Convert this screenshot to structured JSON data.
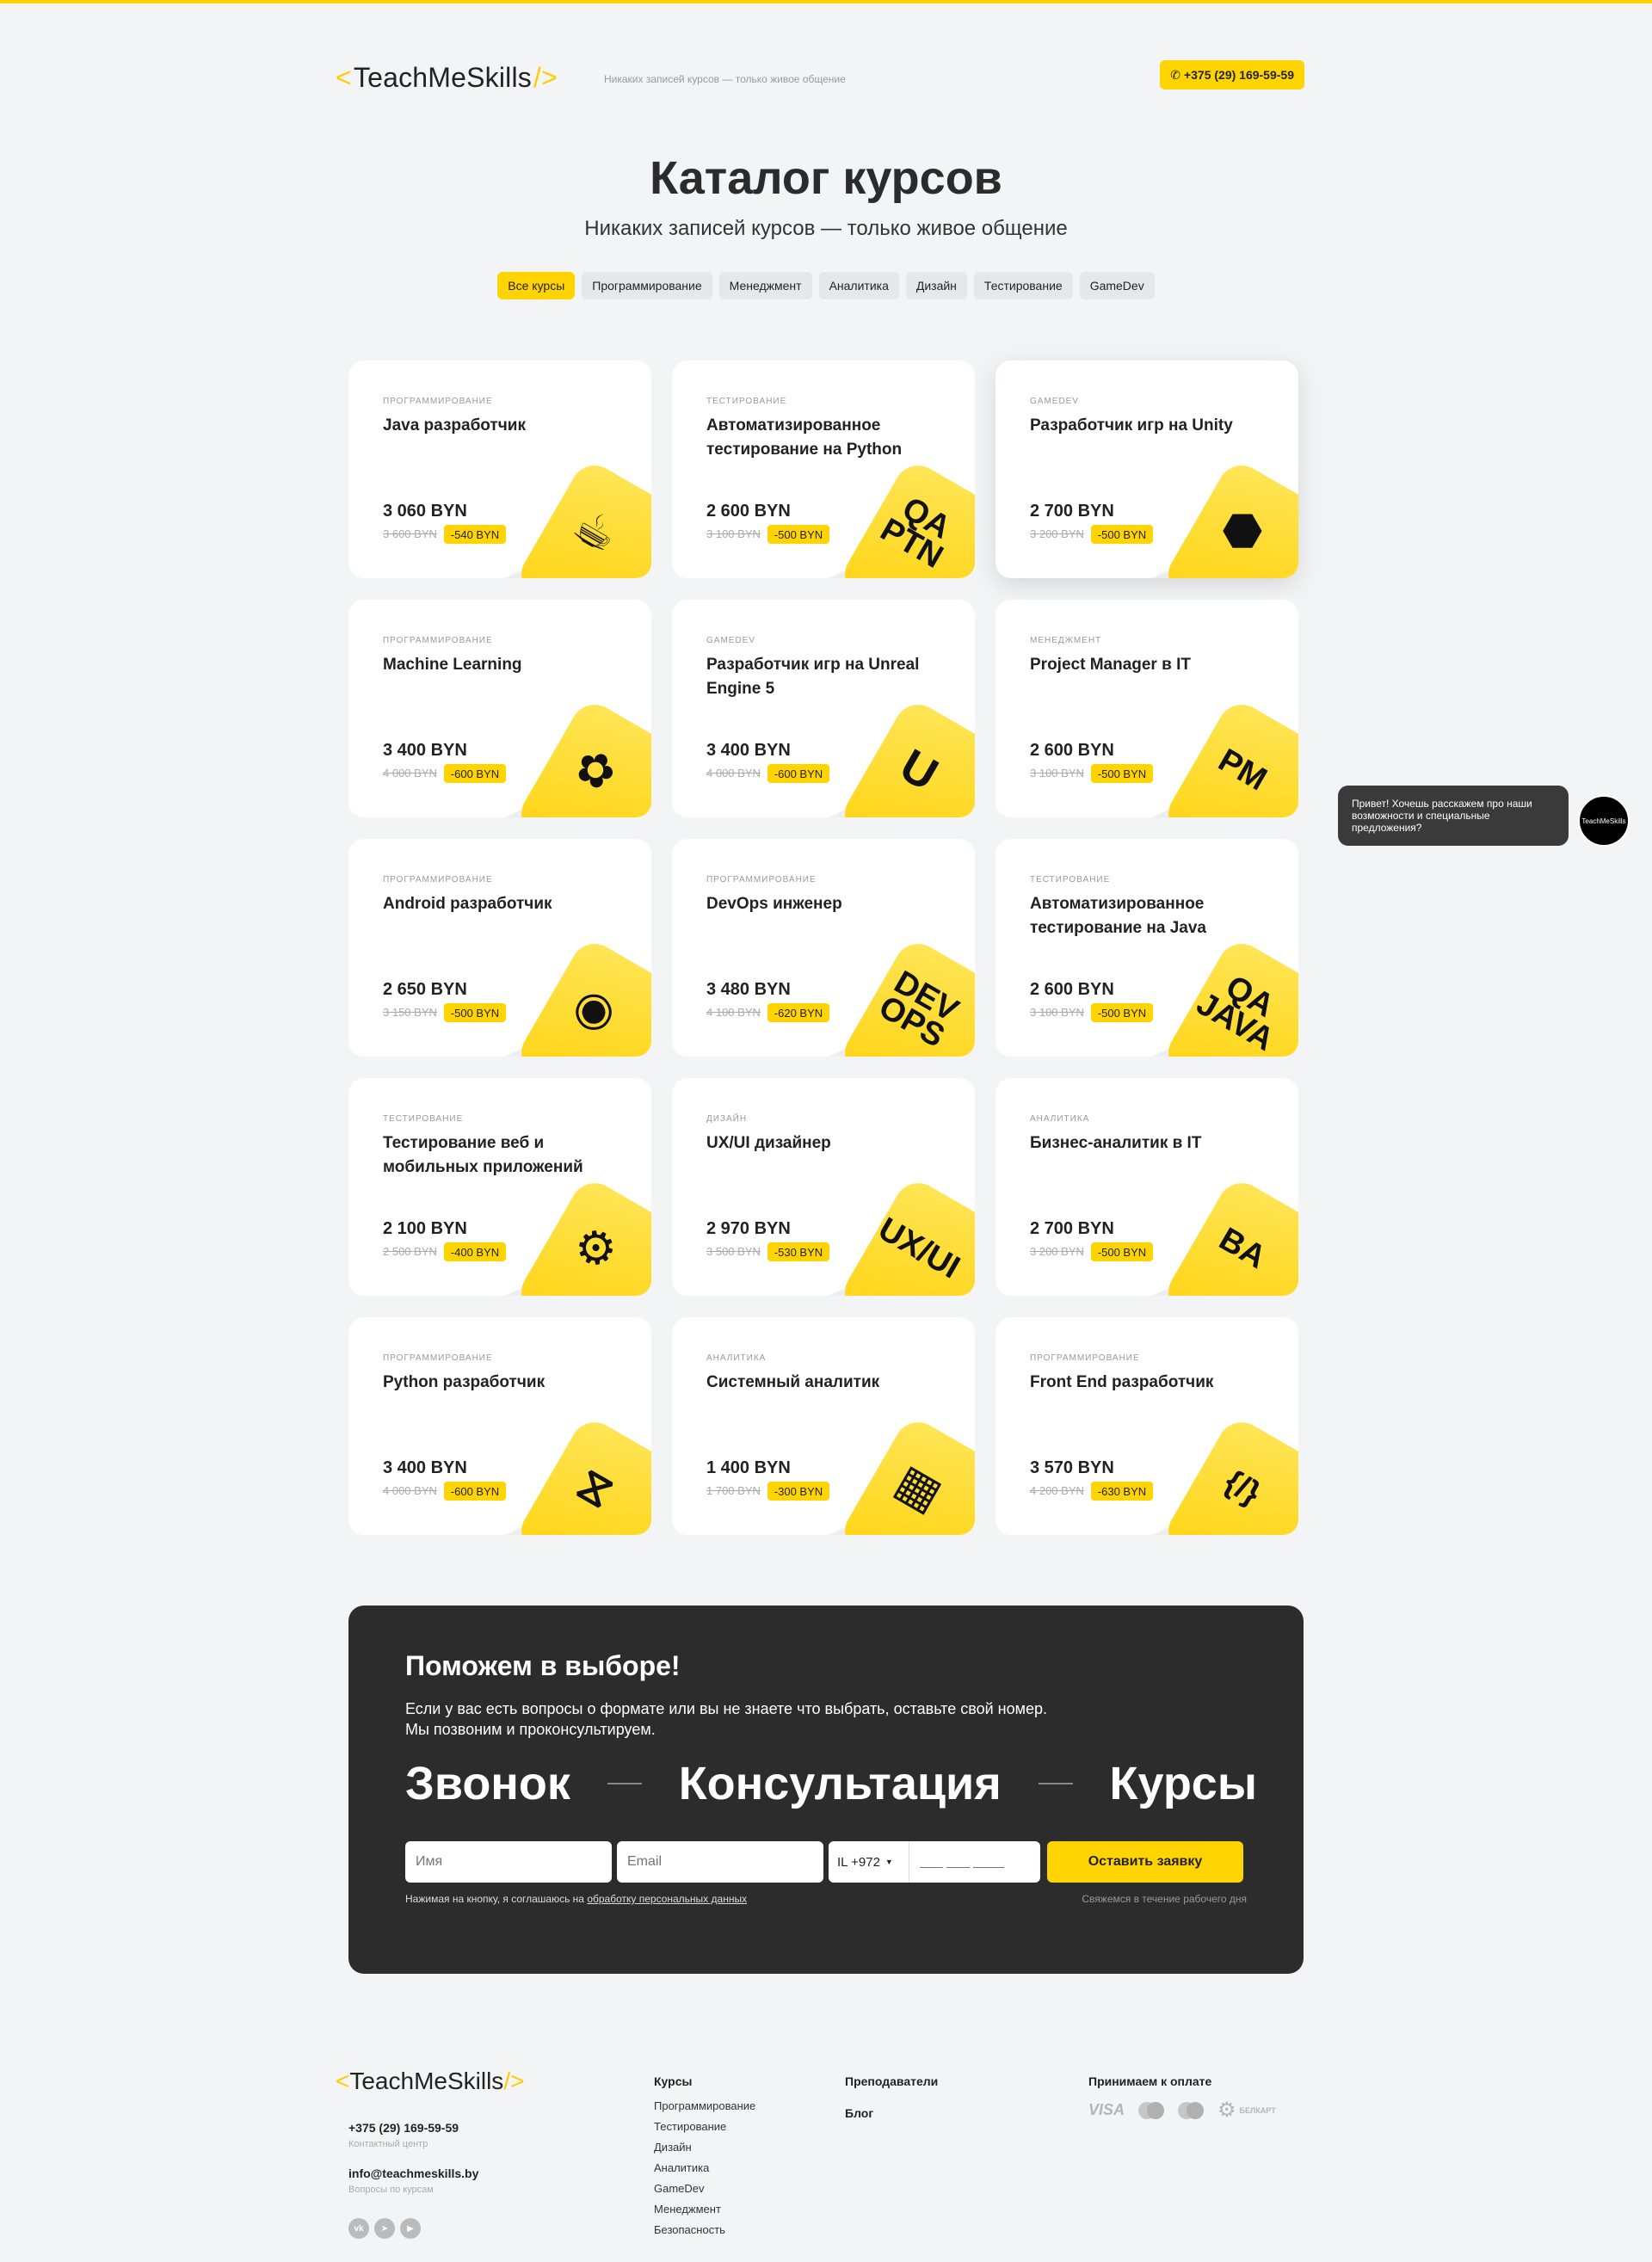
{
  "header": {
    "logo_text": "TeachMeSkills",
    "logo_left": "<",
    "logo_right": "/>",
    "tagline": "Никаких записей курсов — только живое общение",
    "phone": "+375 (29) 169-59-59",
    "phone_icon": "phone-icon"
  },
  "page": {
    "title": "Каталог курсов",
    "subtitle": "Никаких записей курсов — только живое общение"
  },
  "filters": [
    "Все курсы",
    "Программирование",
    "Менеджмент",
    "Аналитика",
    "Дизайн",
    "Тестирование",
    "GameDev"
  ],
  "courses": [
    {
      "category": "Программирование",
      "name": "Java разработчик",
      "price": "3 060 BYN",
      "old": "3 600 BYN",
      "discount": "-540 BYN",
      "icon": "java-cup-icon",
      "label": ""
    },
    {
      "category": "Тестирование",
      "name": "Автоматизированное тестирование на Python",
      "price": "2 600 BYN",
      "old": "3 100 BYN",
      "discount": "-500 BYN",
      "icon": "qa-python-icon",
      "label": "QA PTN"
    },
    {
      "category": "GameDev",
      "name": "Разработчик игр на Unity",
      "price": "2 700 BYN",
      "old": "3 200 BYN",
      "discount": "-500 BYN",
      "icon": "unity-icon",
      "label": ""
    },
    {
      "category": "Программирование",
      "name": "Machine Learning",
      "price": "3 400 BYN",
      "old": "4 000 BYN",
      "discount": "-600 BYN",
      "icon": "brain-icon",
      "label": ""
    },
    {
      "category": "GameDev",
      "name": "Разработчик игр на Unreal Engine 5",
      "price": "3 400 BYN",
      "old": "4 000 BYN",
      "discount": "-600 BYN",
      "icon": "unreal-icon",
      "label": ""
    },
    {
      "category": "Менеджмент",
      "name": "Project Manager в IT",
      "price": "2 600 BYN",
      "old": "3 100 BYN",
      "discount": "-500 BYN",
      "icon": "pm-icon",
      "label": "PM"
    },
    {
      "category": "Программирование",
      "name": "Android разработчик",
      "price": "2 650 BYN",
      "old": "3 150 BYN",
      "discount": "-500 BYN",
      "icon": "android-icon",
      "label": ""
    },
    {
      "category": "Программирование",
      "name": "DevOps инженер",
      "price": "3 480 BYN",
      "old": "4 100 BYN",
      "discount": "-620 BYN",
      "icon": "devops-icon",
      "label": "DEV OPS"
    },
    {
      "category": "Тестирование",
      "name": "Автоматизированное тестирование на Java",
      "price": "2 600 BYN",
      "old": "3 100 BYN",
      "discount": "-500 BYN",
      "icon": "qa-java-icon",
      "label": "QA JAVA"
    },
    {
      "category": "Тестирование",
      "name": "Тестирование веб и мобильных приложений",
      "price": "2 100 BYN",
      "old": "2 500 BYN",
      "discount": "-400 BYN",
      "icon": "gears-icon",
      "label": ""
    },
    {
      "category": "Дизайн",
      "name": "UX/UI дизайнер",
      "price": "2 970 BYN",
      "old": "3 500 BYN",
      "discount": "-530 BYN",
      "icon": "ux-ui-icon",
      "label": "UX/UI"
    },
    {
      "category": "Аналитика",
      "name": "Бизнес-аналитик в IT",
      "price": "2 700 BYN",
      "old": "3 200 BYN",
      "discount": "-500 BYN",
      "icon": "ba-icon",
      "label": "BA"
    },
    {
      "category": "Программирование",
      "name": "Python разработчик",
      "price": "3 400 BYN",
      "old": "4 000 BYN",
      "discount": "-600 BYN",
      "icon": "python-icon",
      "label": ""
    },
    {
      "category": "Аналитика",
      "name": "Системный аналитик",
      "price": "1 400 BYN",
      "old": "1 700 BYN",
      "discount": "-300 BYN",
      "icon": "chart-icon",
      "label": ""
    },
    {
      "category": "Программирование",
      "name": "Front End разработчик",
      "price": "3 570 BYN",
      "old": "4 200 BYN",
      "discount": "-630 BYN",
      "icon": "code-braces-icon",
      "label": "{/}"
    }
  ],
  "chat": {
    "message": "Привет! Хочешь расскажем про наши возможности и специальные предложения?",
    "avatar_text": "TeachMeSkills"
  },
  "help": {
    "title": "Поможем в выборе!",
    "desc_line1": "Если у вас есть вопросы о формате или вы не знаете что выбрать, оставьте свой номер.",
    "desc_line2": "Мы позвоним и проконсультируем.",
    "word1": "Звонок",
    "word2": "Консультация",
    "word3": "Курсы",
    "name_placeholder": "Имя",
    "email_placeholder": "Email",
    "country_code": "IL +972",
    "phone_placeholder": "___ ___ ____",
    "submit": "Оставить заявку",
    "agree_text": "Нажимая на кнопку, я соглашаюсь на",
    "agree_link": "обработку персональных данных",
    "callback_note": "Свяжемся в течение рабочего дня"
  },
  "footer": {
    "logo_text": "TeachMeSkills",
    "phone": "+375 (29) 169-59-59",
    "phone_note": "Контактный центр",
    "email": "info@teachmeskills.by",
    "email_note": "Вопросы по курсам",
    "courses_head": "Курсы",
    "course_links": [
      "Программирование",
      "Тестирование",
      "Дизайн",
      "Аналитика",
      "GameDev",
      "Менеджмент",
      "Безопасность"
    ],
    "teachers": "Преподаватели",
    "blog": "Блог",
    "payment_head": "Принимаем к оплате",
    "visa": "VISA",
    "belkart": "БЕЛКАРТ",
    "socials": [
      "vk-icon",
      "telegram-icon",
      "youtube-icon"
    ]
  },
  "colors": {
    "accent": "#ffd400",
    "dark_block": "#2c2c2c",
    "background": "#f3f4f6"
  }
}
